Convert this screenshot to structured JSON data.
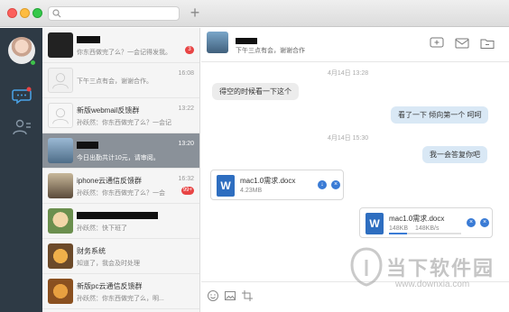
{
  "colors": {
    "rail": "#2e3a45",
    "accent": "#3a7bd5",
    "badge": "#e84444",
    "active_item": "#8a9199"
  },
  "conversations": [
    {
      "name": "",
      "snippet": "你东西做完了么？一会记得发我。",
      "time": "",
      "badge": "3",
      "active": false
    },
    {
      "name": "",
      "snippet": "下午三点有会，谢谢合作。",
      "time": "16:08",
      "badge": "",
      "active": false
    },
    {
      "name": "新版webmail反馈群",
      "snippet": "孙跃然：你东西做完了么？一会记",
      "time": "13:22",
      "badge": "",
      "active": false
    },
    {
      "name": "",
      "snippet": "今日出勤共计10元，请审阅。",
      "time": "13:20",
      "badge": "",
      "active": true
    },
    {
      "name": "iphone云通信反馈群",
      "snippet": "孙跃然：你东西做完了么？一会",
      "time": "16:32",
      "badge": "99+",
      "active": false
    },
    {
      "name": "",
      "snippet": "孙跃然：快下班了",
      "time": "",
      "badge": "",
      "active": false
    },
    {
      "name": "财务系统",
      "snippet": "知道了，我会及时处理",
      "time": "",
      "badge": "",
      "active": false
    },
    {
      "name": "新版pc云通信反馈群",
      "snippet": "孙跃然：你东西做完了么，明...",
      "time": "",
      "badge": "",
      "active": false
    }
  ],
  "chat": {
    "header_status": "下午三点有会，谢谢合作",
    "time_1": "4月14日  13:28",
    "msg_1": "得空的时候看一下这个",
    "msg_2": "看了一下 倾向第一个 呵呵",
    "time_2": "4月14日  15:30",
    "msg_3": "我一会答复你吧",
    "file_1": {
      "name": "mac1.0需求.docx",
      "size": "4.23MB"
    },
    "file_2": {
      "name": "mac1.0需求.docx",
      "size": "148KB",
      "speed": "148KB/s",
      "progress": 0.25
    }
  },
  "watermark": {
    "title": "当下软件园",
    "url": "www.downxia.com"
  }
}
